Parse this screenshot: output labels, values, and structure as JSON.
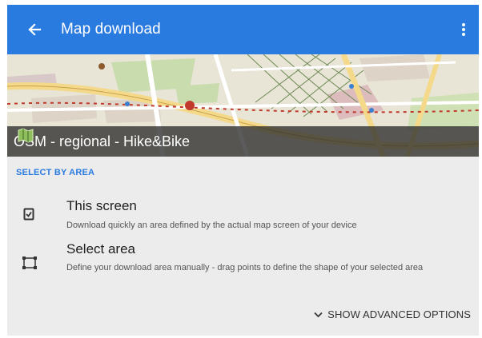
{
  "appbar": {
    "title": "Map download",
    "back_icon": "arrow-left-icon",
    "menu_icon": "more-vertical-icon",
    "color": "#2a7be0"
  },
  "map_preview": {
    "label": "OSM - regional - Hike&Bike"
  },
  "section": {
    "header": "SELECT BY AREA"
  },
  "options": [
    {
      "title": "This screen",
      "description": "Download quickly an area defined by the actual map screen of your device",
      "icon": "screen-check-icon"
    },
    {
      "title": "Select area",
      "description": "Define your download area manually - drag points to define the shape of your selected area",
      "icon": "select-area-icon"
    }
  ],
  "advanced": {
    "label": "SHOW ADVANCED OPTIONS",
    "icon": "chevron-down-icon"
  }
}
